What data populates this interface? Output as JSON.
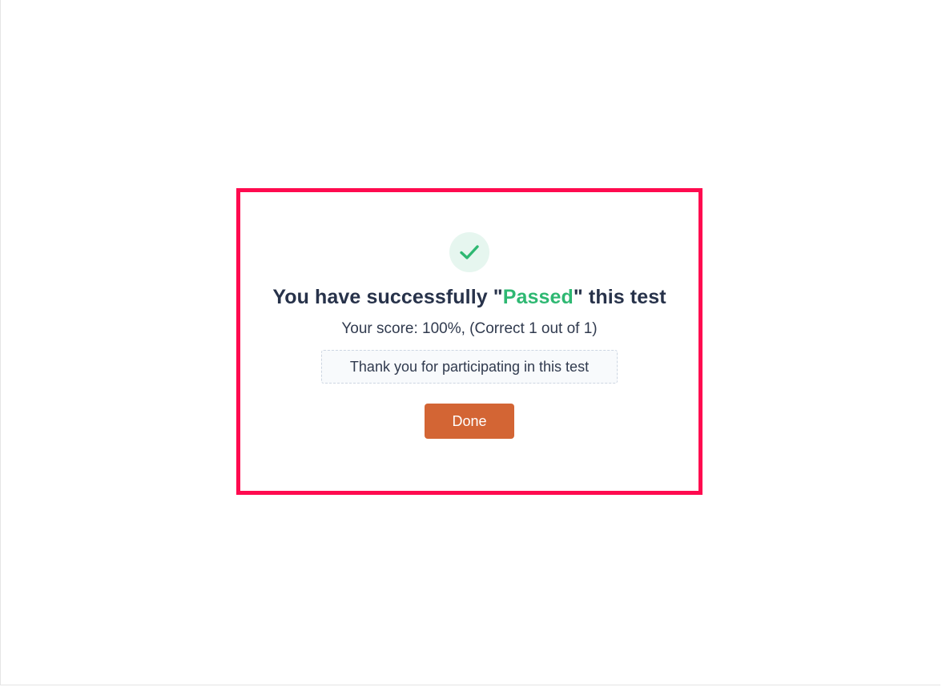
{
  "result": {
    "icon": "check-icon",
    "title_prefix": "You have successfully \"",
    "title_status": "Passed",
    "title_suffix": "\" this test",
    "score_text": "Your score: 100%, (Correct 1 out of 1)",
    "thanks_text": "Thank you for participating in this test",
    "done_label": "Done"
  },
  "colors": {
    "highlight_border": "#ff0a4f",
    "passed": "#2eb872",
    "done_button": "#d36534",
    "icon_bg": "#e6f6ef"
  }
}
